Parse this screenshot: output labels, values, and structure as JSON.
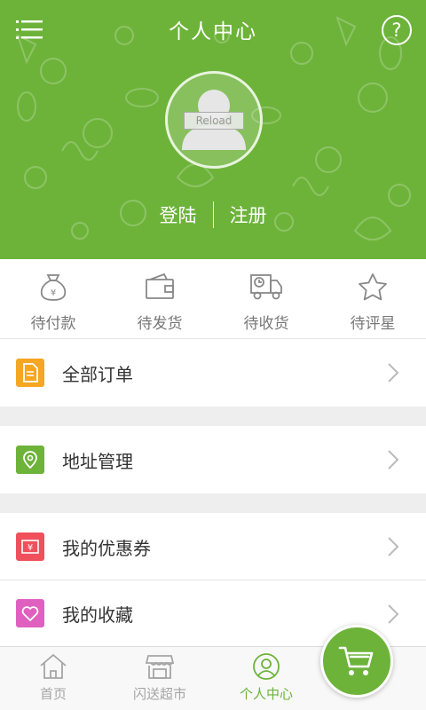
{
  "header": {
    "title": "个人中心",
    "menu_icon": "menu-icon",
    "help_label": "?",
    "avatar_overlay_text": "Reload",
    "login_label": "登陆",
    "register_label": "注册",
    "background_color": "#6db33a"
  },
  "order_status": [
    {
      "icon": "money-bag-icon",
      "label": "待付款"
    },
    {
      "icon": "wallet-icon",
      "label": "待发货"
    },
    {
      "icon": "delivery-truck-icon",
      "label": "待收货"
    },
    {
      "icon": "star-icon",
      "label": "待评星"
    }
  ],
  "menu_list": [
    {
      "icon": "order-document-icon",
      "label": "全部订单",
      "icon_color": "#f5a623"
    },
    {
      "icon": "location-pin-icon",
      "label": "地址管理",
      "icon_color": "#6db33a"
    },
    {
      "icon": "coupon-icon",
      "label": "我的优惠券",
      "icon_color": "#f0505c"
    },
    {
      "icon": "heart-icon",
      "label": "我的收藏",
      "icon_color": "#e060c0"
    }
  ],
  "bottom_nav": [
    {
      "icon": "home-icon",
      "label": "首页",
      "active": false
    },
    {
      "icon": "storefront-icon",
      "label": "闪送超市",
      "active": false
    },
    {
      "icon": "user-circle-icon",
      "label": "个人中心",
      "active": true
    }
  ],
  "cart_button": {
    "icon": "shopping-cart-icon"
  },
  "colors": {
    "accent": "#6db33a",
    "inactive_nav": "#a5a5a5",
    "divider": "#eeeeee"
  }
}
